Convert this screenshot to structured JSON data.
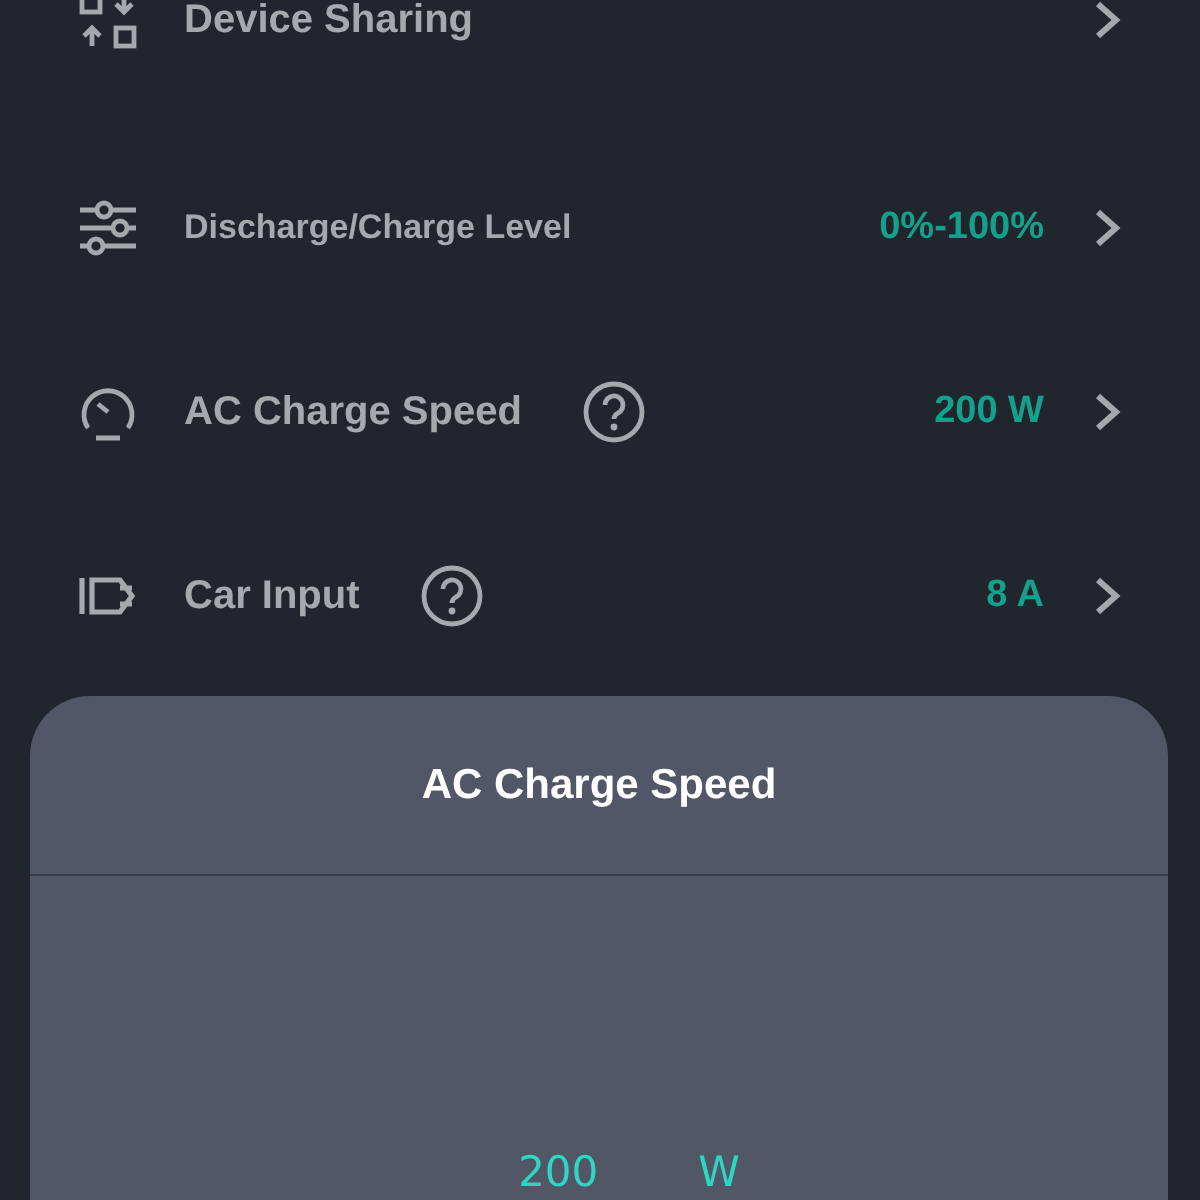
{
  "settings": [
    {
      "label": "Device Sharing",
      "help": false
    },
    {
      "label": "Discharge/Charge Level",
      "help": false,
      "value": "0%-100%"
    },
    {
      "label": "AC Charge Speed",
      "help": true,
      "value": "200 W"
    },
    {
      "label": "Car Input",
      "help": true,
      "value": "8 A"
    }
  ],
  "sheet": {
    "title": "AC Charge Speed",
    "picker_value": "200",
    "picker_unit": "W"
  }
}
